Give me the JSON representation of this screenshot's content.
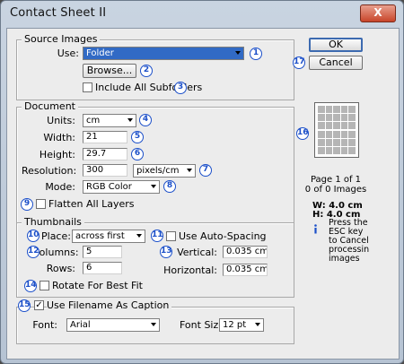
{
  "window": {
    "title": "Contact Sheet II",
    "close_glyph": "X"
  },
  "buttons": {
    "ok": "OK",
    "cancel": "Cancel",
    "browse": "Browse..."
  },
  "source_images": {
    "heading": "Source Images",
    "use_label": "Use:",
    "use_value": "Folder",
    "include_subfolders_label": "Include All Subfolders",
    "include_subfolders_checked": false
  },
  "document": {
    "heading": "Document",
    "units_label": "Units:",
    "units_value": "cm",
    "width_label": "Width:",
    "width_value": "21",
    "height_label": "Height:",
    "height_value": "29.7",
    "resolution_label": "Resolution:",
    "resolution_value": "300",
    "resolution_unit": "pixels/cm",
    "mode_label": "Mode:",
    "mode_value": "RGB Color",
    "flatten_label": "Flatten All Layers",
    "flatten_checked": false
  },
  "thumbnails": {
    "heading": "Thumbnails",
    "place_label": "Place:",
    "place_value": "across first",
    "autospacing_label": "Use Auto-Spacing",
    "autospacing_checked": false,
    "columns_label": "Columns:",
    "columns_value": "5",
    "rows_label": "Rows:",
    "rows_value": "6",
    "vertical_label": "Vertical:",
    "vertical_value": "0.035 cm",
    "horizontal_label": "Horizontal:",
    "horizontal_value": "0.035 cm",
    "rotate_label": "Rotate For Best Fit",
    "rotate_checked": false
  },
  "caption": {
    "use_filename_label": "Use Filename As Caption",
    "use_filename_checked": true,
    "check_glyph": "✓",
    "font_label": "Font:",
    "font_value": "Arial",
    "font_size_label": "Font Size:",
    "font_size_value": "12 pt"
  },
  "preview": {
    "page_info": "Page 1 of 1",
    "images_info": "0 of 0 Images",
    "width_info": "W: 4.0 cm",
    "height_info": "H: 4.0 cm",
    "esc_note": [
      "Press the",
      "ESC key",
      "to Cancel",
      "processin",
      "images"
    ],
    "grid_columns": 5,
    "grid_rows": 6
  },
  "badges": [
    "1",
    "2",
    "3",
    "4",
    "5",
    "6",
    "7",
    "8",
    "9",
    "10",
    "11",
    "12",
    "13",
    "14",
    "15",
    "16",
    "17"
  ],
  "colors": {
    "badge": "#1b4fc9",
    "selection": "#316ac5"
  }
}
